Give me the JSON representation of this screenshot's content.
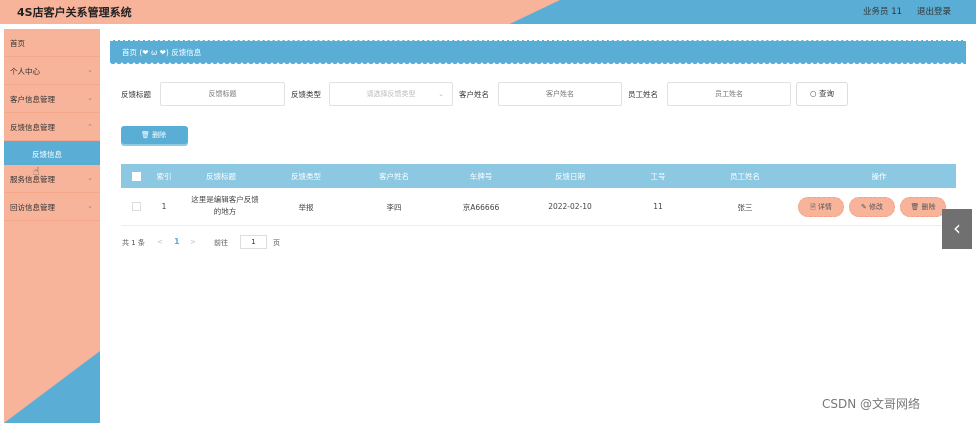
{
  "header": {
    "title": "4S店客户关系管理系统",
    "user_label": "业务员 11",
    "logout_label": "退出登录"
  },
  "sidebar": {
    "items": [
      {
        "label": "首页",
        "has_chevron": false
      },
      {
        "label": "个人中心",
        "has_chevron": true
      },
      {
        "label": "客户信息管理",
        "has_chevron": true
      },
      {
        "label": "反馈信息管理",
        "has_chevron": true
      },
      {
        "label": "服务信息管理",
        "has_chevron": true
      },
      {
        "label": "回访信息管理",
        "has_chevron": true
      }
    ],
    "active_sub": "反馈信息",
    "chevron_glyph": "⌄"
  },
  "breadcrumb": {
    "text": "首页 (❤ ω ❤) 反馈信息"
  },
  "search": {
    "title_label": "反馈标题",
    "title_placeholder": "反馈标题",
    "type_label": "反馈类型",
    "type_placeholder": "请选择反馈类型",
    "customer_label": "客户姓名",
    "customer_placeholder": "客户姓名",
    "staff_label": "员工姓名",
    "staff_placeholder": "员工姓名",
    "query_label": "○ 查询"
  },
  "actions": {
    "delete_label": "🗑 删除"
  },
  "table": {
    "headers": [
      "索引",
      "反馈标题",
      "反馈类型",
      "客户姓名",
      "车牌号",
      "反馈日期",
      "工号",
      "员工姓名",
      "操作"
    ],
    "rows": [
      {
        "index": "1",
        "title": "这里是编辑客户反馈的地方",
        "type": "举报",
        "customer": "李四",
        "plate": "京A66666",
        "date": "2022-02-10",
        "staff_id": "11",
        "staff_name": "张三",
        "detail_label": "🗎 详情",
        "edit_label": "✎ 修改",
        "delete_label": "🗑 删除"
      }
    ]
  },
  "pager": {
    "total": "共 1 条",
    "prev": "<",
    "current": "1",
    "next": ">",
    "goto": "前往",
    "page_value": "1",
    "page_unit": "页"
  },
  "side_toggle": "‹",
  "watermark": "CSDN @文哥网络",
  "colors": {
    "accent_blue": "#5aaed6",
    "accent_salmon": "#f7b49a",
    "table_header": "#8cc8e2"
  }
}
